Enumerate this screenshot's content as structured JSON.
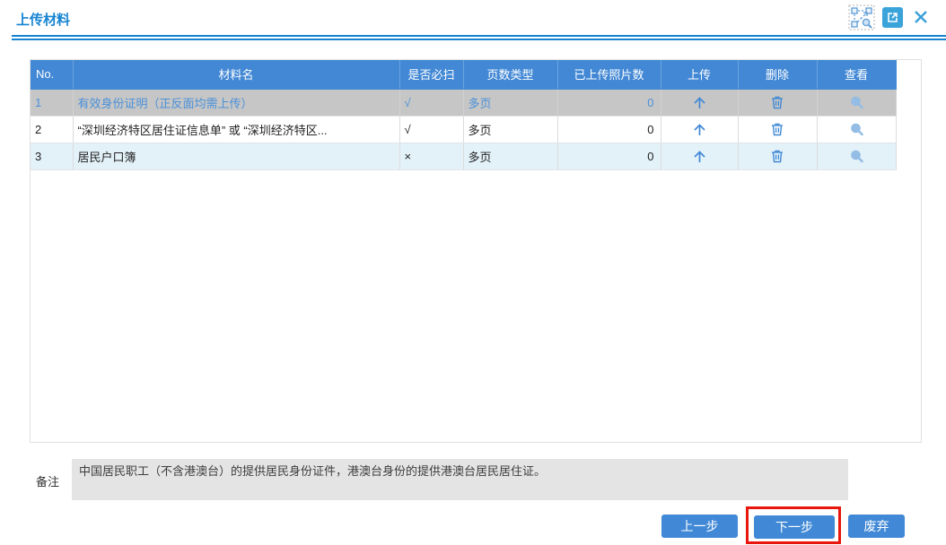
{
  "dialog": {
    "title": "上传材料"
  },
  "header_icons": {
    "zoom_region": "zoom-region-icon",
    "open_external": "open-external-icon",
    "close": "close-icon"
  },
  "table": {
    "columns": [
      "No.",
      "材料名",
      "是否必扫",
      "页数类型",
      "已上传照片数",
      "上传",
      "删除",
      "查看"
    ],
    "rows": [
      {
        "no": "1",
        "name": "有效身份证明（正反面均需上传）",
        "required": "√",
        "page_type": "多页",
        "uploaded_count": "0",
        "selected": true
      },
      {
        "no": "2",
        "name": "“深圳经济特区居住证信息单” 或 “深圳经济特区...",
        "required": "√",
        "page_type": "多页",
        "uploaded_count": "0",
        "selected": false
      },
      {
        "no": "3",
        "name": "居民户口簿",
        "required": "×",
        "page_type": "多页",
        "uploaded_count": "0",
        "selected": false
      }
    ]
  },
  "remark": {
    "label": "备注",
    "text": "中国居民职工（不含港澳台）的提供居民身份证件，港澳台身份的提供港澳台居民居住证。"
  },
  "buttons": {
    "previous": "上一步",
    "next": "下一步",
    "discard": "废弃"
  },
  "colors": {
    "title_blue": "#1584d2",
    "table_header_bg": "#4288d5",
    "selected_row_bg": "#c6c6c6",
    "selected_row_text": "#4a90d9",
    "alt_row_bg": "#e3f1f9",
    "button_bg": "#4189d6",
    "annotation_red": "#e8160c",
    "remark_bg": "#e4e4e4"
  }
}
